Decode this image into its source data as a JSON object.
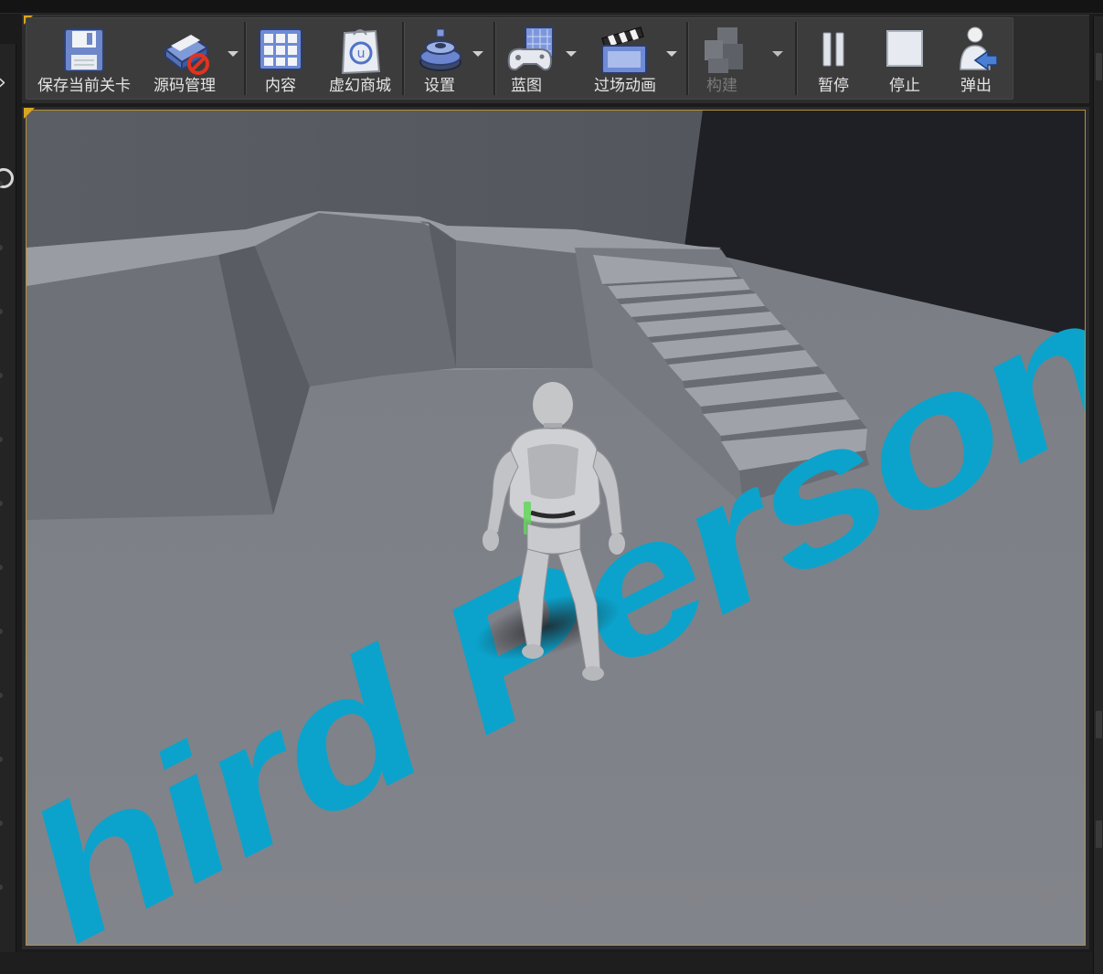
{
  "toolbar": {
    "save_current_level": "保存当前关卡",
    "source_control": "源码管理",
    "content": "内容",
    "marketplace": "虚幻商城",
    "settings": "设置",
    "blueprints": "蓝图",
    "cinematics": "过场动画",
    "build": "构建",
    "pause": "暂停",
    "stop": "停止",
    "eject": "弹出"
  },
  "viewport": {
    "floor_text": "hird Person"
  },
  "colors": {
    "selection_border": "#b8922e",
    "floor_text": "#0ba3cc",
    "floor": "#7d7f86",
    "wall_dark": "#1c1e24"
  }
}
